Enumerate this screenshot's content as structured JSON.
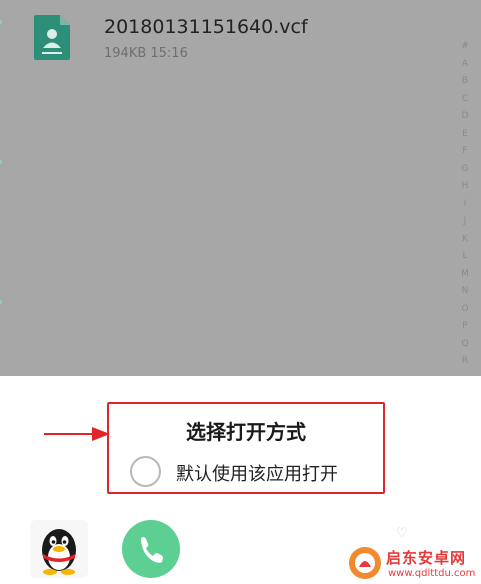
{
  "file": {
    "name": "20180131151640.vcf",
    "meta": "194KB  15:16",
    "icon": "vcf-file-icon"
  },
  "index_letters": [
    "#",
    "A",
    "B",
    "C",
    "D",
    "E",
    "F",
    "G",
    "H",
    "I",
    "J",
    "K",
    "L",
    "M",
    "N",
    "O",
    "P",
    "Q",
    "R"
  ],
  "dialog": {
    "title": "选择打开方式",
    "default_option": "默认使用该应用打开"
  },
  "apps": [
    {
      "name": "qq-app",
      "icon": "qq-penguin-icon"
    },
    {
      "name": "phone-app",
      "icon": "phone-handset-icon"
    }
  ],
  "watermark": {
    "text": "启东安卓网",
    "url": "www.qdlttdu.com"
  },
  "colors": {
    "overlay": "#a7a7a7",
    "highlight": "#e0242a",
    "phone": "#5dcf92",
    "file_icon": "#2e8f78"
  }
}
